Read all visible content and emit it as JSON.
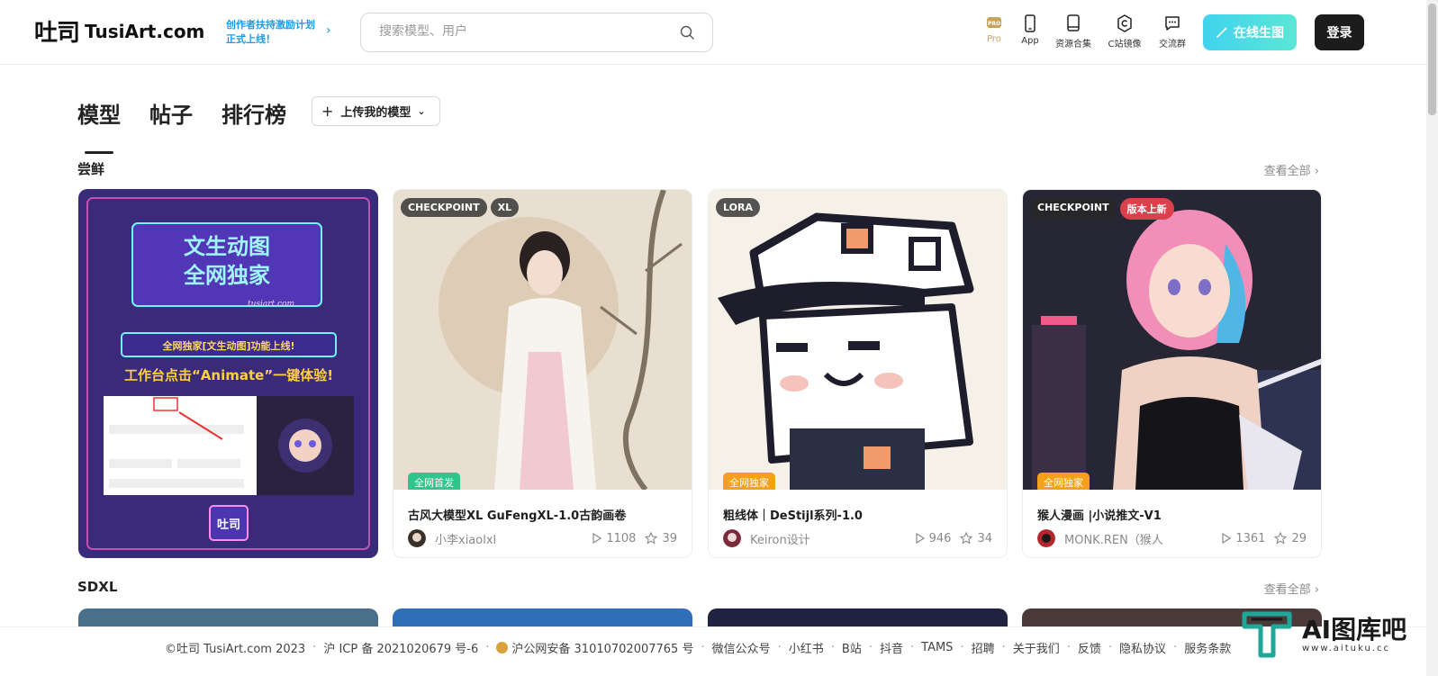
{
  "header": {
    "logo_mark": "吐司",
    "logo_text": "TusiArt.com",
    "promo_line1": "创作者扶持激励计划",
    "promo_line2": "正式上线！",
    "search_placeholder": "搜索模型、用户",
    "nav": [
      {
        "label": "Pro",
        "icon": "pro-icon"
      },
      {
        "label": "App",
        "icon": "phone-icon"
      },
      {
        "label": "资源合集",
        "icon": "book-icon"
      },
      {
        "label": "C站镜像",
        "icon": "civitai-icon"
      },
      {
        "label": "交流群",
        "icon": "chat-icon"
      }
    ],
    "generate_label": "在线生图",
    "login_label": "登录"
  },
  "tabs": [
    {
      "label": "模型",
      "active": true
    },
    {
      "label": "帖子",
      "active": false
    },
    {
      "label": "排行榜",
      "active": false
    }
  ],
  "upload_label": "上传我的模型",
  "sections": [
    {
      "title": "尝鲜",
      "view_all": "查看全部"
    },
    {
      "title": "SDXL",
      "view_all": "查看全部"
    }
  ],
  "banner": {
    "line1": "文生动图",
    "line2": "全网独家",
    "url": "tusiart.com",
    "ribbon": "全网独家[文生动图]功能上线!",
    "cta": "工作台点击“Animate”一键体验!",
    "logo": "吐司"
  },
  "cards": [
    {
      "tags": [
        "CHECKPOINT",
        "XL"
      ],
      "badge": "全网首发",
      "badge_color": "#2fc68c",
      "title": "古风大模型XL GuFengXL-1.0古韵画卷",
      "author": "小李xiaolxl",
      "runs": "1108",
      "stars": "39"
    },
    {
      "tags": [
        "LORA"
      ],
      "badge": "全网独家",
      "badge_color": "#f5a01a",
      "title": "粗线体｜DeStijl系列-1.0",
      "author": "Keiron设计",
      "runs": "946",
      "stars": "34"
    },
    {
      "tags": [
        "CHECKPOINT"
      ],
      "new_tag": "版本上新",
      "badge": "全网独家",
      "badge_color": "#f5a01a",
      "title": "猴人漫画 |小说推文-V1",
      "author": "MONK.REN（猴人",
      "runs": "1361",
      "stars": "29"
    }
  ],
  "footer": {
    "copyright": "©吐司 TusiArt.com 2023",
    "icp": "沪 ICP 备 2021020679 号-6",
    "police": "沪公网安备 31010702007765 号",
    "links": [
      "微信公众号",
      "小红书",
      "B站",
      "抖音",
      "TAMS",
      "招聘",
      "关于我们",
      "反馈",
      "隐私协议",
      "服务条款"
    ]
  },
  "watermark": {
    "main": "AI图库吧",
    "sub": "www.aituku.cc"
  }
}
